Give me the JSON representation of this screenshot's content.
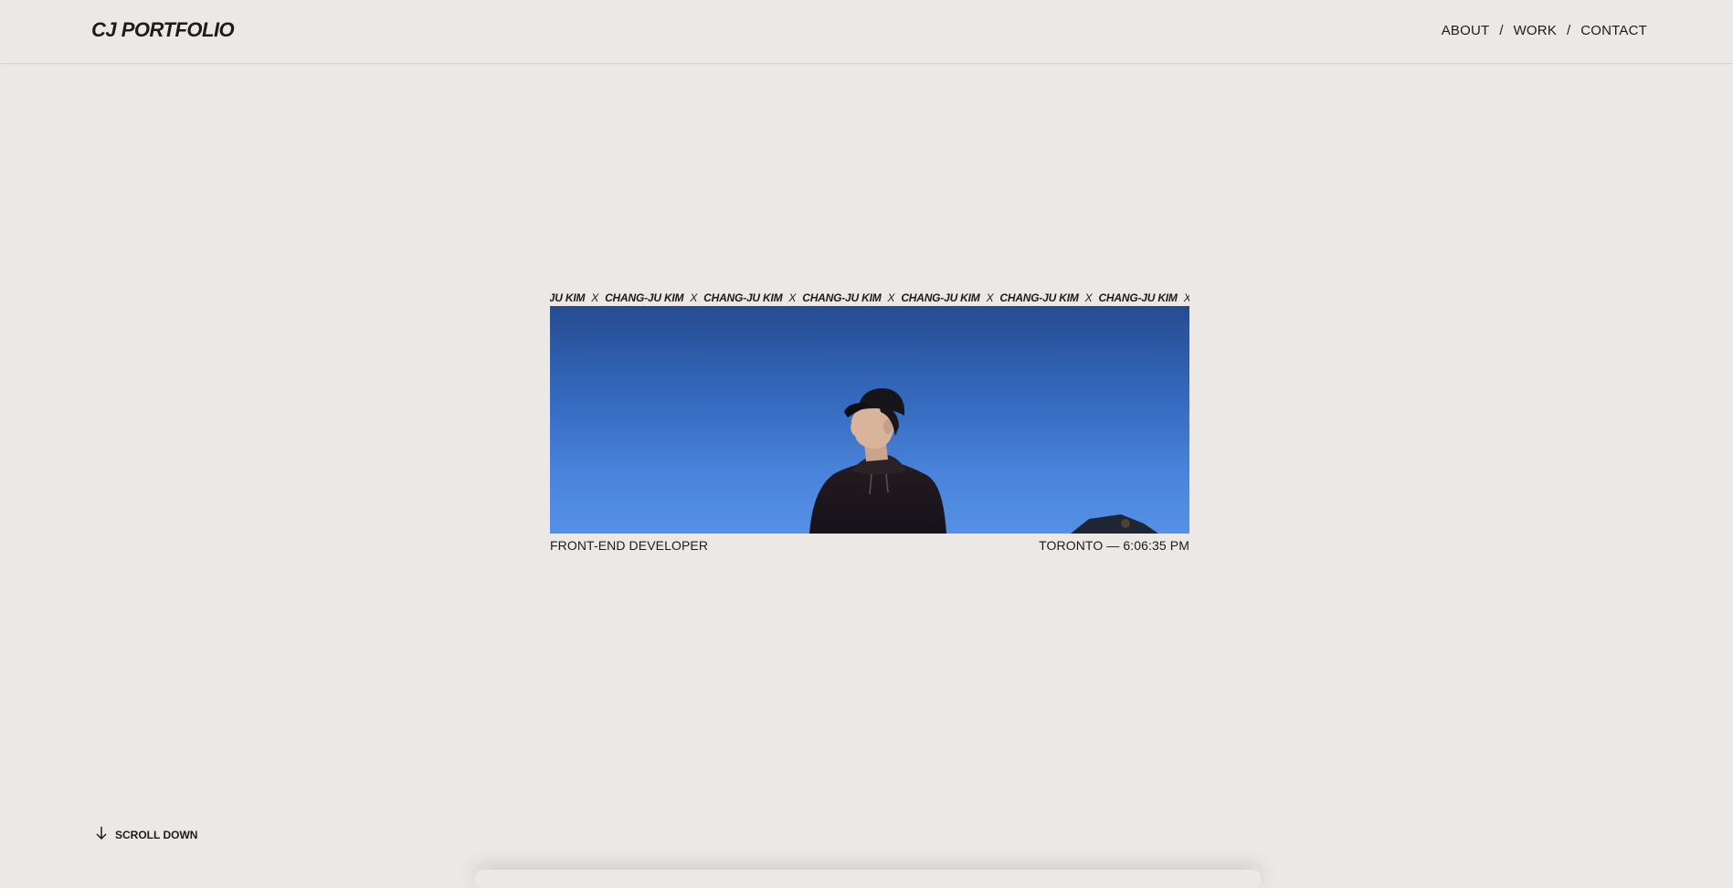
{
  "header": {
    "logo": "CJ PORTFOLIO",
    "nav": [
      {
        "label": "ABOUT"
      },
      {
        "label": "WORK"
      },
      {
        "label": "CONTACT"
      }
    ],
    "separator": "/"
  },
  "hero": {
    "marquee_name": "CHANG-JU KIM",
    "marquee_separator": "X",
    "photo_alt": "Portrait of Chang-Ju Kim against blue sky",
    "role": "FRONT-END DEVELOPER",
    "location_time": "TORONTO — 6:06:35 PM"
  },
  "scroll": {
    "label": "SCROLL DOWN",
    "icon": "arrow-down-icon"
  },
  "colors": {
    "background": "#ebe8e5",
    "text": "#1c1c1c",
    "sky_top": "#254c92",
    "sky_bottom": "#5590e6"
  }
}
